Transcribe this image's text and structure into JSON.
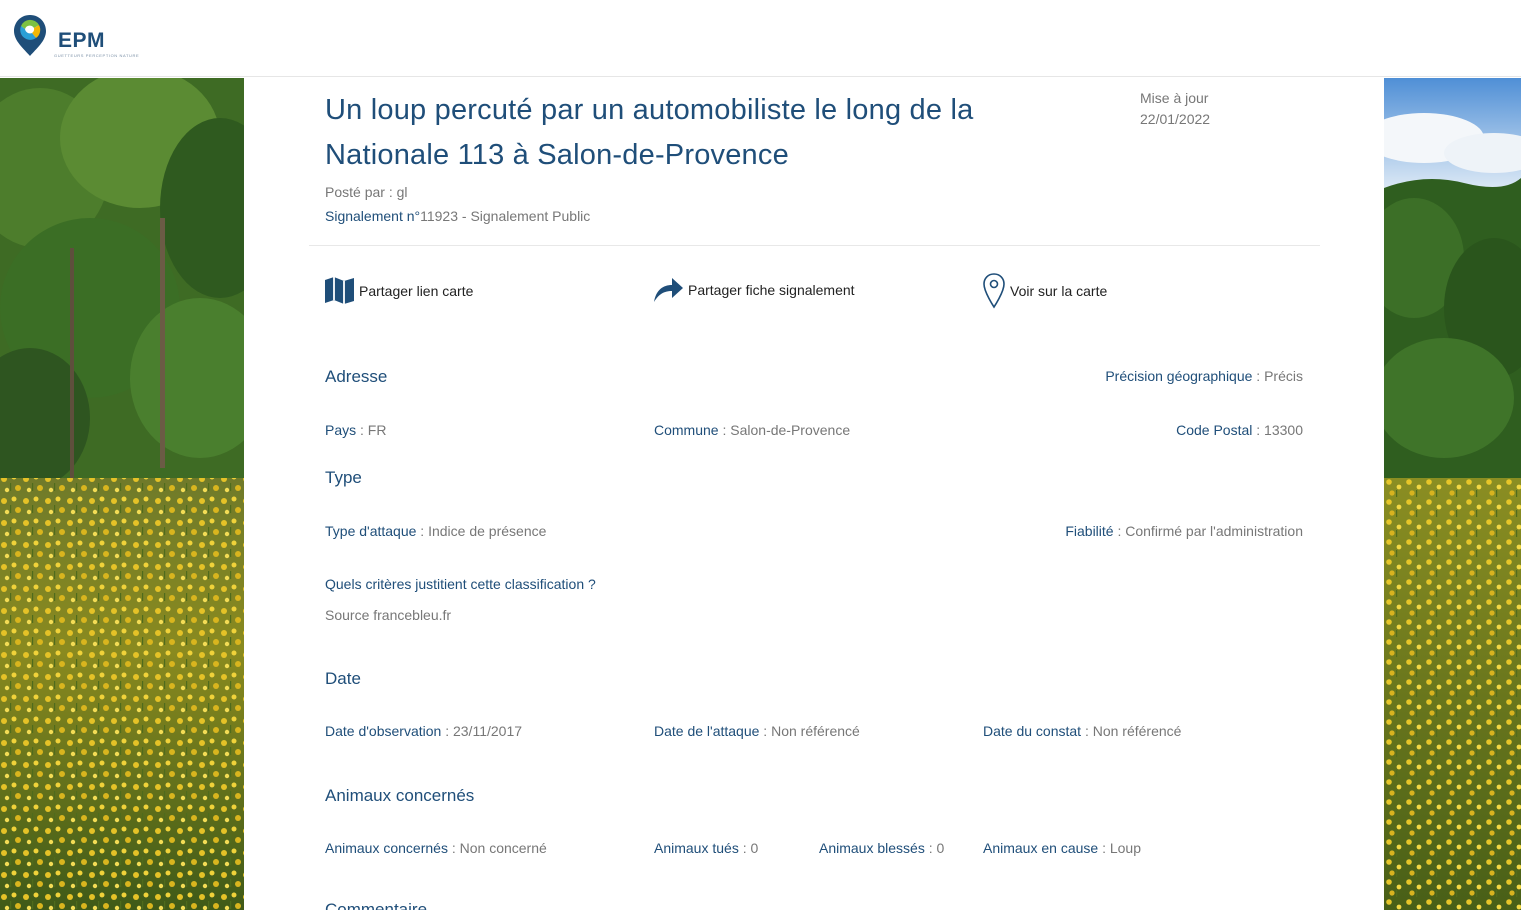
{
  "brand": {
    "name": "EPM",
    "tagline": "GUETTEURS PERCEPTION NATURE"
  },
  "report": {
    "title": "Un loup percuté par un automobiliste le long de la Nationale 113 à Salon-de-Provence",
    "update_label": "Mise à jour",
    "update_date": "22/01/2022",
    "posted_by_label": "Posté par :",
    "posted_by": "gl",
    "signalement_label": "Signalement n°",
    "signalement_value": "11923 - Signalement Public"
  },
  "actions": {
    "share_map": "Partager lien carte",
    "share_report": "Partager fiche signalement",
    "view_map": "Voir sur la carte"
  },
  "address": {
    "heading": "Adresse",
    "precision_label": "Précision géographique",
    "precision_value": " : Précis",
    "country_label": "Pays",
    "country_value": " : FR",
    "commune_label": "Commune",
    "commune_value": " : Salon-de-Provence",
    "postal_label": "Code Postal",
    "postal_value": " : 13300"
  },
  "type": {
    "heading": "Type",
    "attack_label": "Type d'attaque",
    "attack_value": " : Indice de présence",
    "reliability_label": "Fiabilité",
    "reliability_value": " : Confirmé par l'administration",
    "criteria_question": "Quels critères justitient cette classification ?",
    "criteria_answer": "Source francebleu.fr"
  },
  "date": {
    "heading": "Date",
    "observation_label": "Date d'observation",
    "observation_value": " : 23/11/2017",
    "attack_label": "Date de l'attaque",
    "attack_value": " : Non référencé",
    "finding_label": "Date du constat",
    "finding_value": " : Non référencé"
  },
  "animals": {
    "heading": "Animaux concernés",
    "concerned_label": "Animaux concernés",
    "concerned_value": " : Non concerné",
    "killed_label": "Animaux tués",
    "killed_value": " : 0",
    "injured_label": "Animaux blessés",
    "injured_value": " : 0",
    "cause_label": "Animaux en cause",
    "cause_value": " : Loup"
  },
  "comment": {
    "heading": "Commentaire"
  }
}
